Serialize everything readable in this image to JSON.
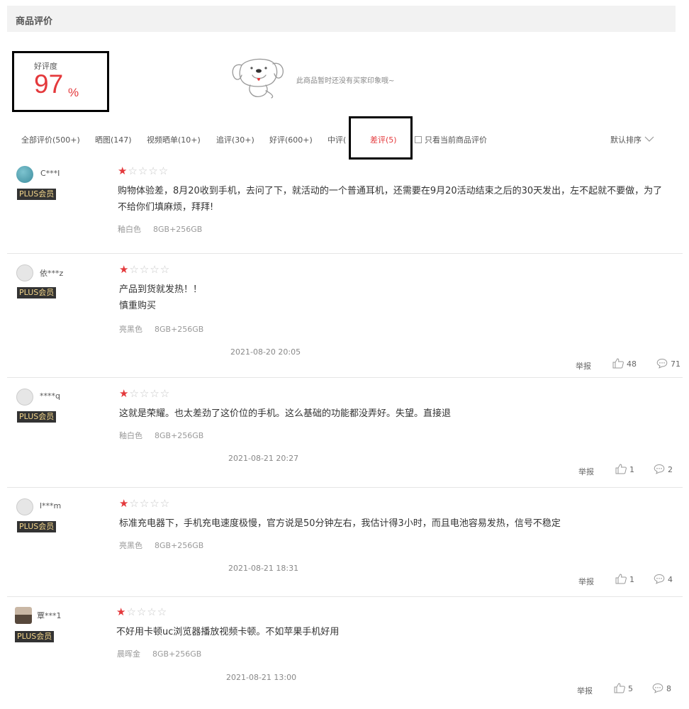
{
  "header": {
    "title": "商品评价"
  },
  "rating": {
    "label": "好评度",
    "value": "97",
    "unit": "%"
  },
  "impression": {
    "empty_text": "此商品暂时还没有买家印象哦~"
  },
  "tabs": [
    {
      "label": "全部评价(500+)"
    },
    {
      "label": "晒图(147)"
    },
    {
      "label": "视频晒单(10+)"
    },
    {
      "label": "追评(30+)"
    },
    {
      "label": "好评(600+)"
    },
    {
      "label": "中评("
    },
    {
      "label": "差评(5)"
    }
  ],
  "filter": {
    "only_current_label": "只看当前商品评价"
  },
  "sort": {
    "label": "默认排序"
  },
  "reviews": [
    {
      "user": "C***I",
      "badge": "PLUS会员",
      "stars": 1,
      "content": "购物体验差，8月20收到手机，去问了下，就活动的一个普通耳机，还需要在9月20活动结束之后的30天发出，左不起就不要做，为了不给你们填麻烦，拜拜!",
      "color": "釉白色",
      "spec": "8GB+256GB"
    },
    {
      "user": "依***z",
      "badge": "PLUS会员",
      "stars": 1,
      "content": "产品到货就发热！！\n慎重购买",
      "color": "亮黑色",
      "spec": "8GB+256GB",
      "date": "2021-08-20 20:05",
      "report": "举报",
      "likes": "48",
      "replies": "71"
    },
    {
      "user": "****q",
      "badge": "PLUS会员",
      "stars": 1,
      "content": "这就是荣耀。也太差劲了这价位的手机。这么基础的功能都没弄好。失望。直接退",
      "color": "釉白色",
      "spec": "8GB+256GB",
      "date": "2021-08-21 20:27",
      "report": "举报",
      "likes": "1",
      "replies": "2"
    },
    {
      "user": "l***m",
      "badge": "PLUS会员",
      "stars": 1,
      "content": "标准充电器下，手机充电速度极慢，官方说是50分钟左右，我估计得3小时，而且电池容易发热，信号不稳定",
      "color": "亮黑色",
      "spec": "8GB+256GB",
      "date": "2021-08-21 18:31",
      "report": "举报",
      "likes": "1",
      "replies": "4"
    },
    {
      "user": "覃***1",
      "badge": "PLUS会员",
      "stars": 1,
      "content": "不好用卡顿uc浏览器播放视频卡顿。不如苹果手机好用",
      "color": "晨晖金",
      "spec": "8GB+256GB",
      "date": "2021-08-21 13:00",
      "report": "举报",
      "likes": "5",
      "replies": "8"
    }
  ],
  "colors": {
    "accent": "#e4393c",
    "badge_bg": "#333333",
    "badge_text": "#f3d58a"
  }
}
